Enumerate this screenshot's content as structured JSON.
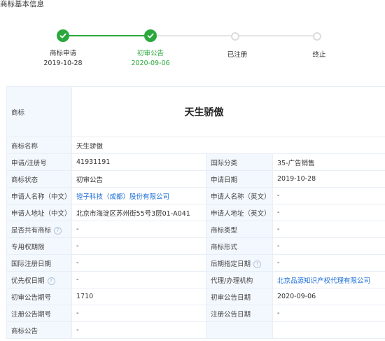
{
  "section_title": "商标基本信息",
  "timeline": [
    {
      "title": "商标申请",
      "date": "2019-10-28",
      "state": "done"
    },
    {
      "title": "初审公告",
      "date": "2020-09-06",
      "state": "active"
    },
    {
      "title": "已注册",
      "date": "",
      "state": "todo"
    },
    {
      "title": "终止",
      "date": "",
      "state": "todo"
    }
  ],
  "colors": {
    "accent_green": "#2aa83c",
    "link_blue": "#1e6fd8",
    "label_bg": "#f3f8fe"
  },
  "icons": {
    "check": "check-icon",
    "help": "question-circle-icon"
  },
  "trademark": {
    "label": "商标",
    "image_text": "天生骄傲",
    "name_label": "商标名称",
    "name_value": "天生骄傲"
  },
  "rows": [
    {
      "l1": "申请/注册号",
      "v1": "41931191",
      "l2": "国际分类",
      "v2": "35-广告销售"
    },
    {
      "l1": "商标状态",
      "v1": "初审公告",
      "l2": "申请日期",
      "v2": "2019-10-28"
    },
    {
      "l1": "申请人名称（中文）",
      "v1": "镗子科技（成都）股份有限公司",
      "l2": "申请人名称（英文）",
      "v2": "-"
    },
    {
      "l1": "申请人地址（中文）",
      "v1": "北京市海淀区苏州街55号3层01-A041",
      "l2": "申请人地址（英文）",
      "v2": "-"
    },
    {
      "l1": "是否共有商标",
      "v1": "-",
      "l2": "商标类型",
      "v2": "-"
    },
    {
      "l1": "专用权期限",
      "v1": "-",
      "l2": "商标形式",
      "v2": "-"
    },
    {
      "l1": "国际注册日期",
      "v1": "-",
      "l2": "后期指定日期",
      "v2": "-"
    },
    {
      "l1": "优先权日期",
      "v1": "-",
      "l2": "代理/办理机构",
      "v2": "北京品源知识产权代理有限公司"
    },
    {
      "l1": "初审公告期号",
      "v1": "1710",
      "l2": "初审公告日期",
      "v2": "2020-09-06"
    },
    {
      "l1": "注册公告期号",
      "v1": "-",
      "l2": "注册公告日期",
      "v2": "-"
    },
    {
      "l1": "商标公告",
      "v1": "-",
      "l2": "",
      "v2": ""
    }
  ]
}
